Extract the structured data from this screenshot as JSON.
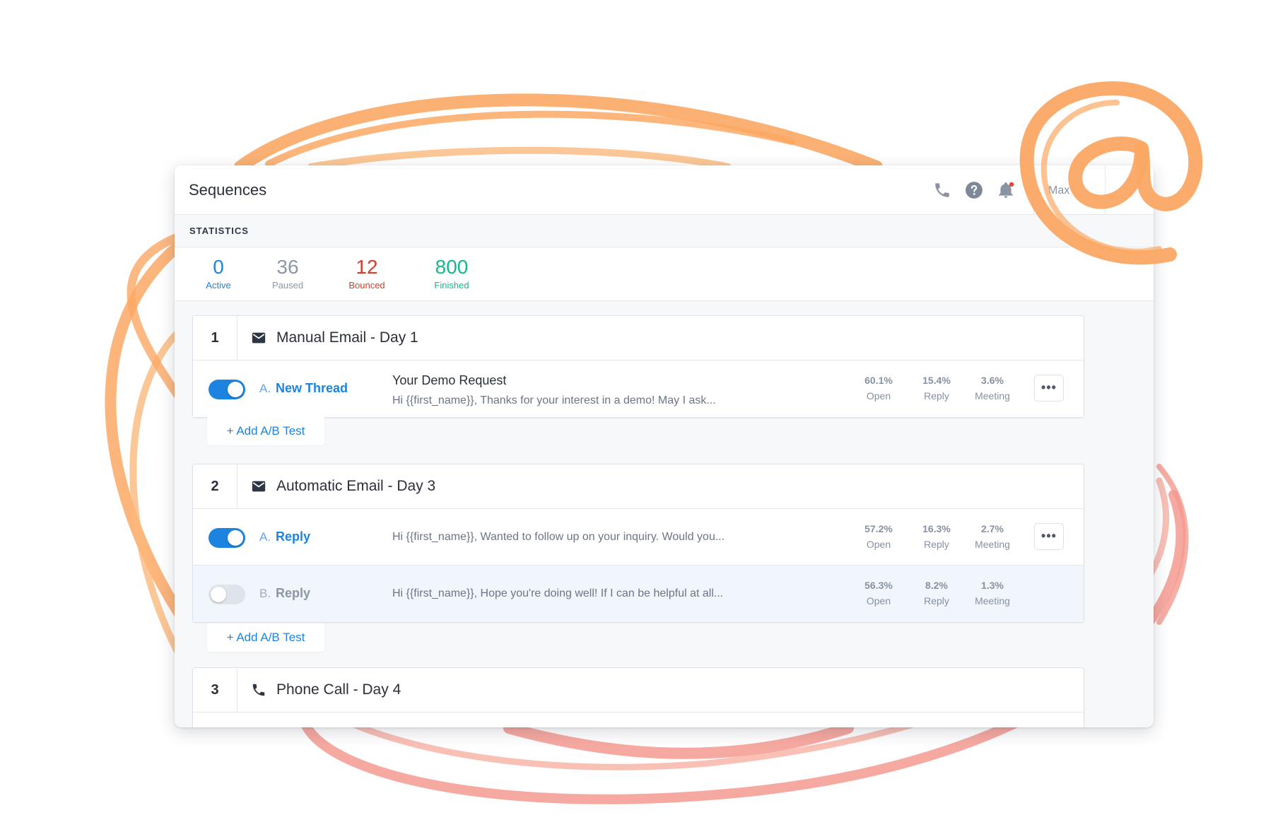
{
  "header": {
    "title": "Sequences",
    "user_name": "Max L"
  },
  "icons": {
    "call": "phone-icon",
    "help": "help-circle-icon",
    "notifications": "bell-icon",
    "email_step": "envelope-icon",
    "call_step": "phone-icon",
    "decoration": "at-sign-doodle"
  },
  "colors": {
    "accent": "#1c84e0",
    "paused": "#8c96a6",
    "bounced": "#d53c2b",
    "finished": "#14b88c",
    "notification_dot": "#e5483b",
    "doodle_orange": "#fba864",
    "doodle_pink": "#f59a8f"
  },
  "statistics": {
    "label": "STATISTICS",
    "items": [
      {
        "value": "0",
        "label": "Active"
      },
      {
        "value": "36",
        "label": "Paused"
      },
      {
        "value": "12",
        "label": "Bounced"
      },
      {
        "value": "800",
        "label": "Finished"
      }
    ]
  },
  "steps": [
    {
      "number": "1",
      "title": "Manual Email - Day 1",
      "variants": [
        {
          "letter": "A.",
          "name": "New Thread",
          "enabled": true,
          "subject": "Your Demo Request",
          "preview": "Hi {{first_name}}, Thanks for your interest in a demo! May I ask...",
          "open": "60.1%",
          "reply": "15.4%",
          "meeting": "3.6%",
          "open_label": "Open",
          "reply_label": "Reply",
          "meeting_label": "Meeting"
        }
      ],
      "ab_test_label": "+ Add A/B Test"
    },
    {
      "number": "2",
      "title": "Automatic Email - Day 3",
      "variants": [
        {
          "letter": "A.",
          "name": "Reply",
          "enabled": true,
          "preview": "Hi {{first_name}}, Wanted to follow up on your inquiry. Would you...",
          "open": "57.2%",
          "reply": "16.3%",
          "meeting": "2.7%",
          "open_label": "Open",
          "reply_label": "Reply",
          "meeting_label": "Meeting"
        },
        {
          "letter": "B.",
          "name": "Reply",
          "enabled": false,
          "preview": "Hi {{first_name}}, Hope you're doing well! If I can be helpful at all...",
          "open": "56.3%",
          "reply": "8.2%",
          "meeting": "1.3%",
          "open_label": "Open",
          "reply_label": "Reply",
          "meeting_label": "Meeting"
        }
      ],
      "ab_test_label": "+ Add A/B Test"
    },
    {
      "number": "3",
      "title": "Phone Call  - Day 4"
    }
  ]
}
